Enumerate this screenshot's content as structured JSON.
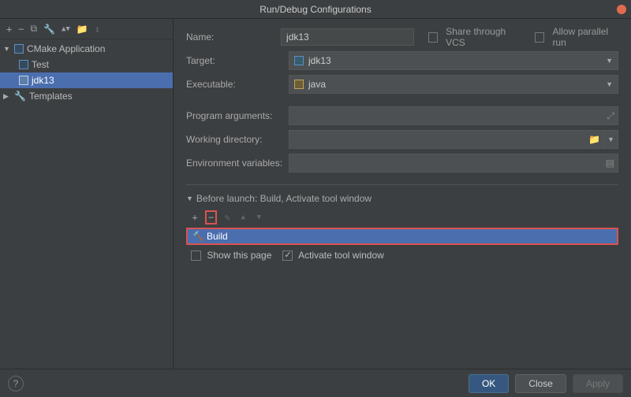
{
  "window": {
    "title": "Run/Debug Configurations"
  },
  "sidebar": {
    "group": "CMake Application",
    "items": [
      "Test",
      "jdk13"
    ],
    "selected": "jdk13",
    "templates": "Templates"
  },
  "form": {
    "name_label": "Name:",
    "name_value": "jdk13",
    "share_vcs": "Share through VCS",
    "allow_parallel": "Allow parallel run",
    "target_label": "Target:",
    "target_value": "jdk13",
    "exe_label": "Executable:",
    "exe_value": "java",
    "progargs_label": "Program arguments:",
    "wdir_label": "Working directory:",
    "env_label": "Environment variables:"
  },
  "before_launch": {
    "header": "Before launch: Build, Activate tool window",
    "task": "Build",
    "show_page": "Show this page",
    "activate_window": "Activate tool window"
  },
  "buttons": {
    "ok": "OK",
    "cancel": "Close",
    "apply": "Apply",
    "help": "?"
  }
}
